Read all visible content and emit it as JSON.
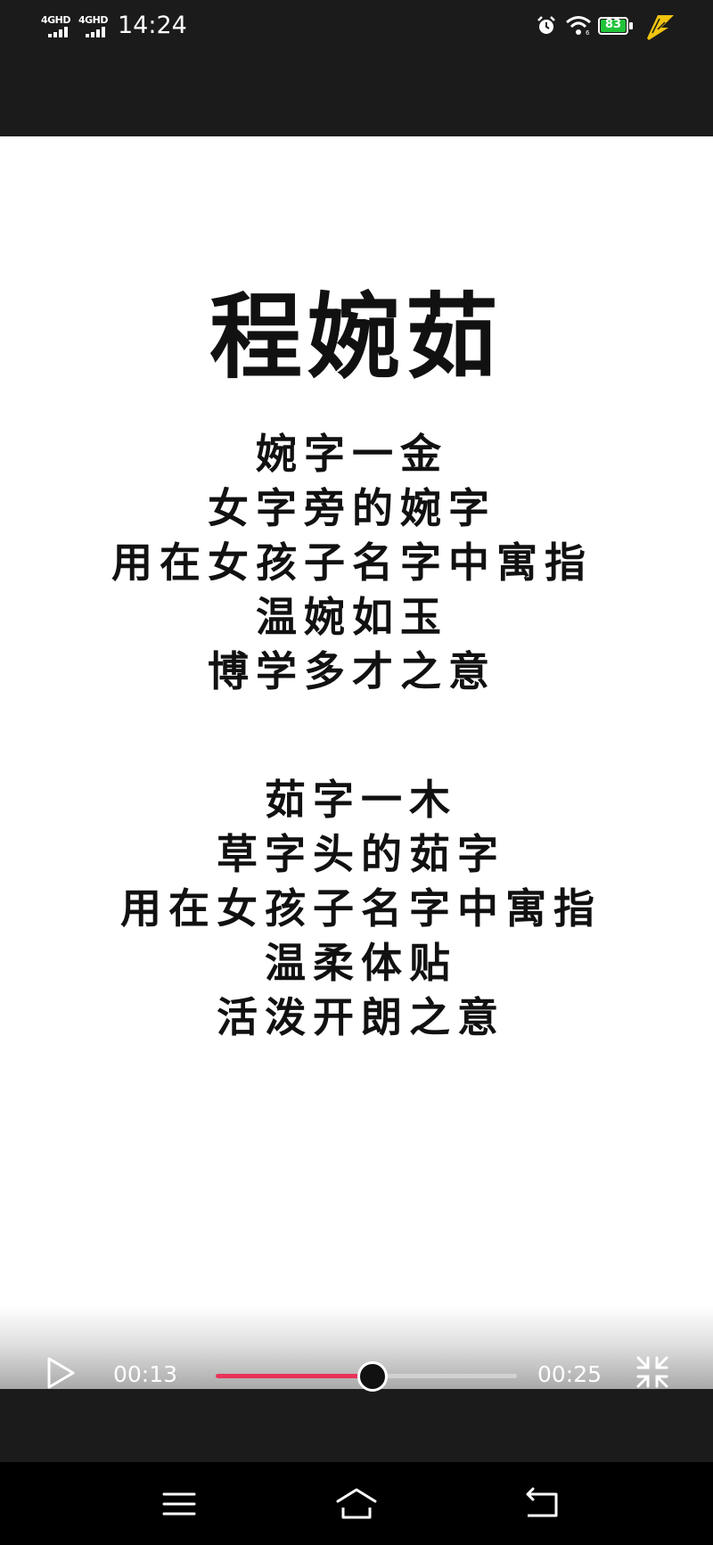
{
  "status_bar": {
    "signal_1": "4GHD",
    "signal_2": "4GHD",
    "time": "14:24",
    "battery_percent": "83",
    "icons": [
      "signal-icon",
      "alarm-icon",
      "wifi-icon",
      "battery-icon",
      "charging-icon"
    ]
  },
  "video": {
    "headline": "程婉茹",
    "verse_1": [
      "婉字一金",
      "女字旁的婉字",
      "用在女孩子名字中寓指",
      "温婉如玉",
      "博学多才之意"
    ],
    "verse_2": [
      "茹字一木",
      "草字头的茹字",
      "用在女孩子名字中寓指",
      "温柔体贴",
      "活泼开朗之意"
    ]
  },
  "player": {
    "current_time": "00:13",
    "duration": "00:25",
    "progress": 0.52,
    "accent_color": "#e8335a",
    "icons": [
      "play-icon",
      "exit-fullscreen-icon"
    ]
  },
  "nav_bar": {
    "icons": [
      "menu-icon",
      "home-icon",
      "back-icon"
    ]
  }
}
